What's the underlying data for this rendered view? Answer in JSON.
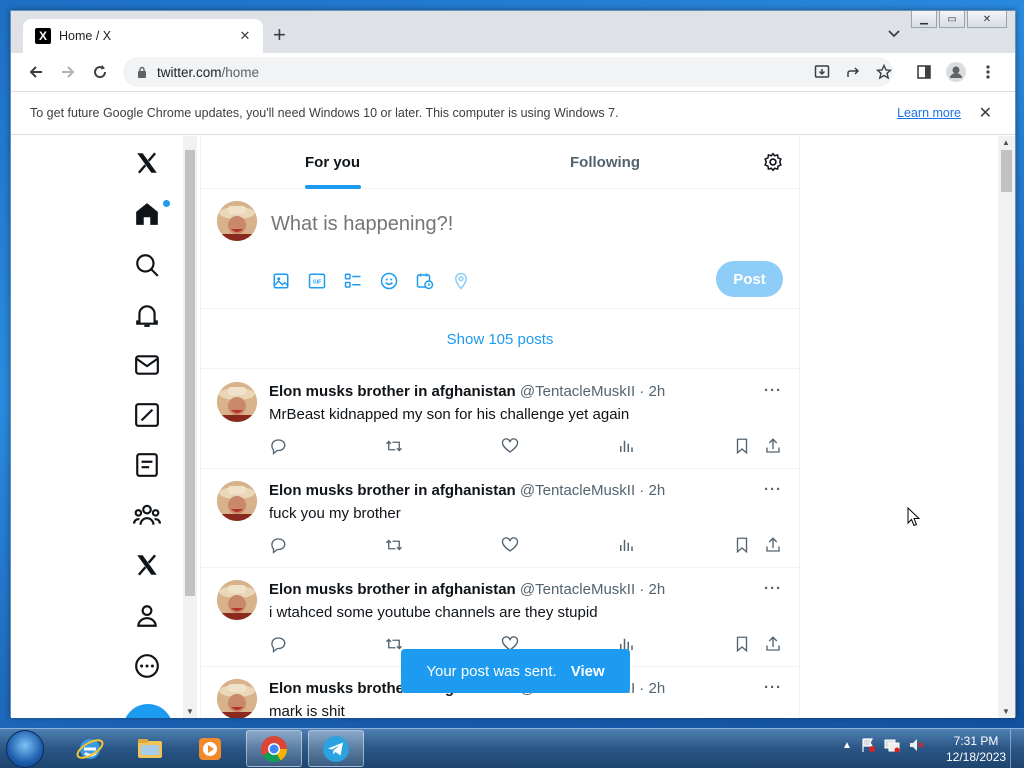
{
  "browser": {
    "tab_title": "Home / X",
    "tab_favicon": "X",
    "url_host": "twitter.com",
    "url_path": "/home",
    "infobar_text": "To get future Google Chrome updates, you'll need Windows 10 or later. This computer is using Windows 7.",
    "infobar_link": "Learn more"
  },
  "x": {
    "tabs": {
      "for_you": "For you",
      "following": "Following"
    },
    "composer": {
      "placeholder": "What is happening?!",
      "post_label": "Post"
    },
    "show_posts": "Show 105 posts",
    "tweets": [
      {
        "name": "Elon musks brother in afghanistan",
        "handle": "@TentacleMuskII · 2h",
        "text": "MrBeast kidnapped my son for his challenge yet again"
      },
      {
        "name": "Elon musks brother in afghanistan",
        "handle": "@TentacleMuskII · 2h",
        "text": "fuck you my brother"
      },
      {
        "name": "Elon musks brother in afghanistan",
        "handle": "@TentacleMuskII · 2h",
        "text": "i wtahced some youtube channels are they stupid"
      },
      {
        "name": "Elon musks brother in afghanistan",
        "handle": "@TentacleMuskII · 2h",
        "text": "mark is shit"
      }
    ],
    "toast": {
      "message": "Your post was sent.",
      "action": "View"
    },
    "accent": "#1d9bf0"
  },
  "taskbar": {
    "time": "7:31 PM",
    "date": "12/18/2023"
  }
}
